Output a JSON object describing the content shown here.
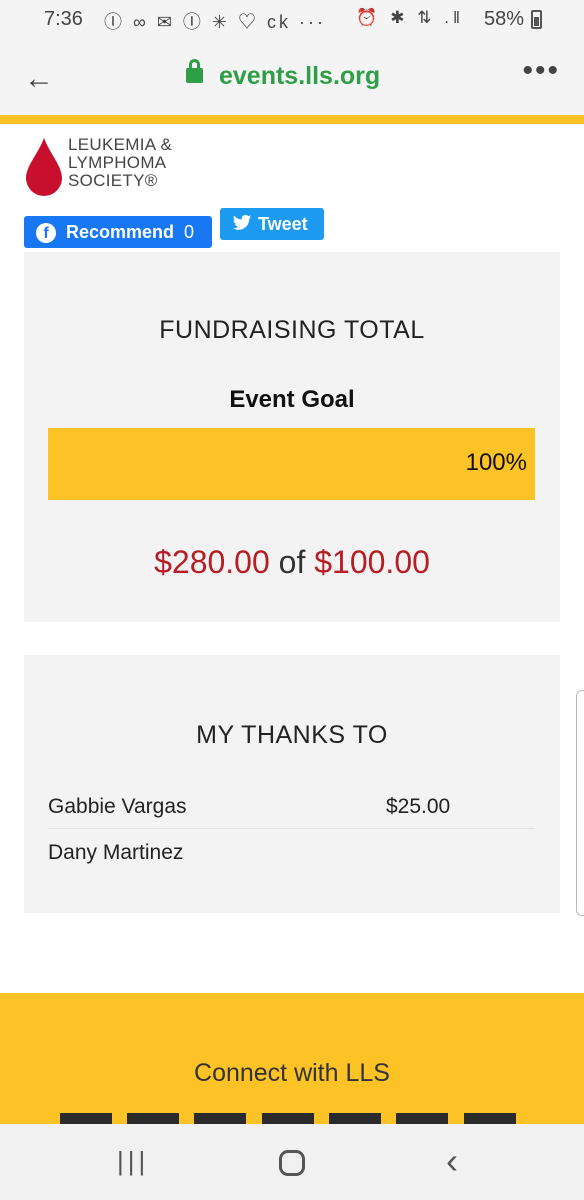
{
  "status_bar": {
    "time": "7:36",
    "notification_icons": "Ⓘ ∞ ✉ Ⓘ ✳ ♡ ck ···",
    "system_icons": "⏰ ✱ ⇅ .‖",
    "battery": "58%"
  },
  "browser": {
    "url": "events.lls.org",
    "back_icon": "←",
    "menu_icon": "•••"
  },
  "logo": {
    "line1": "LEUKEMIA &",
    "line2": "LYMPHOMA",
    "line3": "SOCIETY®"
  },
  "social": {
    "facebook_label": "Recommend",
    "facebook_count": "0",
    "twitter_label": "Tweet"
  },
  "fundraising": {
    "heading": "FUNDRAISING TOTAL",
    "goal_label": "Event Goal",
    "progress_percent": 100,
    "progress_text": "100%",
    "raised": "$280.00",
    "of_word": "of",
    "goal": "$100.00"
  },
  "thanks": {
    "heading": "MY THANKS TO",
    "donors": [
      {
        "name": "Gabbie Vargas",
        "amount": "$25.00"
      },
      {
        "name": "Dany Martinez",
        "amount": ""
      }
    ]
  },
  "footer": {
    "connect_label": "Connect with LLS"
  },
  "nav_bar": {
    "recent_icon": "|||",
    "back_icon": "‹"
  },
  "colors": {
    "accent": "#fcc226",
    "money": "#b81d24",
    "url_green": "#2e9e47",
    "facebook": "#1877f2",
    "twitter": "#1d9bf0"
  }
}
